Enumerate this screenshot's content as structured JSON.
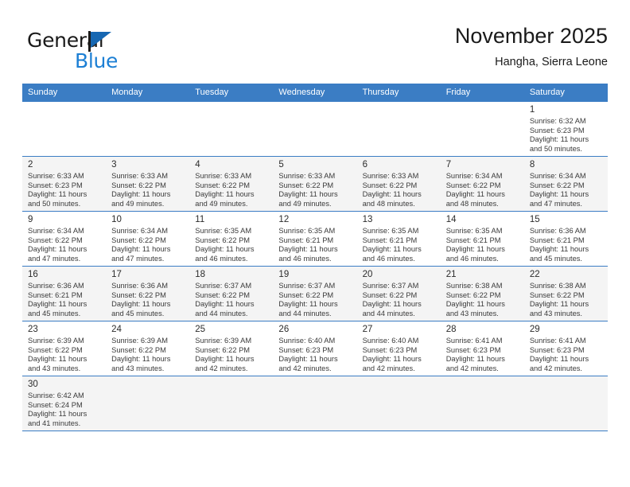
{
  "brand": {
    "name_part1": "General",
    "name_part2": "Blue",
    "flag_icon": "triangle-flag-icon",
    "accent_color": "#1c7fd4",
    "flag_color": "#1667b2"
  },
  "header": {
    "title": "November 2025",
    "subtitle": "Hangha, Sierra Leone"
  },
  "calendar": {
    "header_bg_color": "#3b7dc4",
    "alt_row_bg_color": "#f4f4f4",
    "weekday_headers": [
      "Sunday",
      "Monday",
      "Tuesday",
      "Wednesday",
      "Thursday",
      "Friday",
      "Saturday"
    ],
    "weeks": [
      [
        {
          "day": "",
          "sunrise": "",
          "sunset": "",
          "daylight_line1": "",
          "daylight_line2": ""
        },
        {
          "day": "",
          "sunrise": "",
          "sunset": "",
          "daylight_line1": "",
          "daylight_line2": ""
        },
        {
          "day": "",
          "sunrise": "",
          "sunset": "",
          "daylight_line1": "",
          "daylight_line2": ""
        },
        {
          "day": "",
          "sunrise": "",
          "sunset": "",
          "daylight_line1": "",
          "daylight_line2": ""
        },
        {
          "day": "",
          "sunrise": "",
          "sunset": "",
          "daylight_line1": "",
          "daylight_line2": ""
        },
        {
          "day": "",
          "sunrise": "",
          "sunset": "",
          "daylight_line1": "",
          "daylight_line2": ""
        },
        {
          "day": "1",
          "sunrise": "Sunrise: 6:32 AM",
          "sunset": "Sunset: 6:23 PM",
          "daylight_line1": "Daylight: 11 hours",
          "daylight_line2": "and 50 minutes."
        }
      ],
      [
        {
          "day": "2",
          "sunrise": "Sunrise: 6:33 AM",
          "sunset": "Sunset: 6:23 PM",
          "daylight_line1": "Daylight: 11 hours",
          "daylight_line2": "and 50 minutes."
        },
        {
          "day": "3",
          "sunrise": "Sunrise: 6:33 AM",
          "sunset": "Sunset: 6:22 PM",
          "daylight_line1": "Daylight: 11 hours",
          "daylight_line2": "and 49 minutes."
        },
        {
          "day": "4",
          "sunrise": "Sunrise: 6:33 AM",
          "sunset": "Sunset: 6:22 PM",
          "daylight_line1": "Daylight: 11 hours",
          "daylight_line2": "and 49 minutes."
        },
        {
          "day": "5",
          "sunrise": "Sunrise: 6:33 AM",
          "sunset": "Sunset: 6:22 PM",
          "daylight_line1": "Daylight: 11 hours",
          "daylight_line2": "and 49 minutes."
        },
        {
          "day": "6",
          "sunrise": "Sunrise: 6:33 AM",
          "sunset": "Sunset: 6:22 PM",
          "daylight_line1": "Daylight: 11 hours",
          "daylight_line2": "and 48 minutes."
        },
        {
          "day": "7",
          "sunrise": "Sunrise: 6:34 AM",
          "sunset": "Sunset: 6:22 PM",
          "daylight_line1": "Daylight: 11 hours",
          "daylight_line2": "and 48 minutes."
        },
        {
          "day": "8",
          "sunrise": "Sunrise: 6:34 AM",
          "sunset": "Sunset: 6:22 PM",
          "daylight_line1": "Daylight: 11 hours",
          "daylight_line2": "and 47 minutes."
        }
      ],
      [
        {
          "day": "9",
          "sunrise": "Sunrise: 6:34 AM",
          "sunset": "Sunset: 6:22 PM",
          "daylight_line1": "Daylight: 11 hours",
          "daylight_line2": "and 47 minutes."
        },
        {
          "day": "10",
          "sunrise": "Sunrise: 6:34 AM",
          "sunset": "Sunset: 6:22 PM",
          "daylight_line1": "Daylight: 11 hours",
          "daylight_line2": "and 47 minutes."
        },
        {
          "day": "11",
          "sunrise": "Sunrise: 6:35 AM",
          "sunset": "Sunset: 6:22 PM",
          "daylight_line1": "Daylight: 11 hours",
          "daylight_line2": "and 46 minutes."
        },
        {
          "day": "12",
          "sunrise": "Sunrise: 6:35 AM",
          "sunset": "Sunset: 6:21 PM",
          "daylight_line1": "Daylight: 11 hours",
          "daylight_line2": "and 46 minutes."
        },
        {
          "day": "13",
          "sunrise": "Sunrise: 6:35 AM",
          "sunset": "Sunset: 6:21 PM",
          "daylight_line1": "Daylight: 11 hours",
          "daylight_line2": "and 46 minutes."
        },
        {
          "day": "14",
          "sunrise": "Sunrise: 6:35 AM",
          "sunset": "Sunset: 6:21 PM",
          "daylight_line1": "Daylight: 11 hours",
          "daylight_line2": "and 46 minutes."
        },
        {
          "day": "15",
          "sunrise": "Sunrise: 6:36 AM",
          "sunset": "Sunset: 6:21 PM",
          "daylight_line1": "Daylight: 11 hours",
          "daylight_line2": "and 45 minutes."
        }
      ],
      [
        {
          "day": "16",
          "sunrise": "Sunrise: 6:36 AM",
          "sunset": "Sunset: 6:21 PM",
          "daylight_line1": "Daylight: 11 hours",
          "daylight_line2": "and 45 minutes."
        },
        {
          "day": "17",
          "sunrise": "Sunrise: 6:36 AM",
          "sunset": "Sunset: 6:22 PM",
          "daylight_line1": "Daylight: 11 hours",
          "daylight_line2": "and 45 minutes."
        },
        {
          "day": "18",
          "sunrise": "Sunrise: 6:37 AM",
          "sunset": "Sunset: 6:22 PM",
          "daylight_line1": "Daylight: 11 hours",
          "daylight_line2": "and 44 minutes."
        },
        {
          "day": "19",
          "sunrise": "Sunrise: 6:37 AM",
          "sunset": "Sunset: 6:22 PM",
          "daylight_line1": "Daylight: 11 hours",
          "daylight_line2": "and 44 minutes."
        },
        {
          "day": "20",
          "sunrise": "Sunrise: 6:37 AM",
          "sunset": "Sunset: 6:22 PM",
          "daylight_line1": "Daylight: 11 hours",
          "daylight_line2": "and 44 minutes."
        },
        {
          "day": "21",
          "sunrise": "Sunrise: 6:38 AM",
          "sunset": "Sunset: 6:22 PM",
          "daylight_line1": "Daylight: 11 hours",
          "daylight_line2": "and 43 minutes."
        },
        {
          "day": "22",
          "sunrise": "Sunrise: 6:38 AM",
          "sunset": "Sunset: 6:22 PM",
          "daylight_line1": "Daylight: 11 hours",
          "daylight_line2": "and 43 minutes."
        }
      ],
      [
        {
          "day": "23",
          "sunrise": "Sunrise: 6:39 AM",
          "sunset": "Sunset: 6:22 PM",
          "daylight_line1": "Daylight: 11 hours",
          "daylight_line2": "and 43 minutes."
        },
        {
          "day": "24",
          "sunrise": "Sunrise: 6:39 AM",
          "sunset": "Sunset: 6:22 PM",
          "daylight_line1": "Daylight: 11 hours",
          "daylight_line2": "and 43 minutes."
        },
        {
          "day": "25",
          "sunrise": "Sunrise: 6:39 AM",
          "sunset": "Sunset: 6:22 PM",
          "daylight_line1": "Daylight: 11 hours",
          "daylight_line2": "and 42 minutes."
        },
        {
          "day": "26",
          "sunrise": "Sunrise: 6:40 AM",
          "sunset": "Sunset: 6:23 PM",
          "daylight_line1": "Daylight: 11 hours",
          "daylight_line2": "and 42 minutes."
        },
        {
          "day": "27",
          "sunrise": "Sunrise: 6:40 AM",
          "sunset": "Sunset: 6:23 PM",
          "daylight_line1": "Daylight: 11 hours",
          "daylight_line2": "and 42 minutes."
        },
        {
          "day": "28",
          "sunrise": "Sunrise: 6:41 AM",
          "sunset": "Sunset: 6:23 PM",
          "daylight_line1": "Daylight: 11 hours",
          "daylight_line2": "and 42 minutes."
        },
        {
          "day": "29",
          "sunrise": "Sunrise: 6:41 AM",
          "sunset": "Sunset: 6:23 PM",
          "daylight_line1": "Daylight: 11 hours",
          "daylight_line2": "and 42 minutes."
        }
      ],
      [
        {
          "day": "30",
          "sunrise": "Sunrise: 6:42 AM",
          "sunset": "Sunset: 6:24 PM",
          "daylight_line1": "Daylight: 11 hours",
          "daylight_line2": "and 41 minutes."
        },
        {
          "day": "",
          "sunrise": "",
          "sunset": "",
          "daylight_line1": "",
          "daylight_line2": ""
        },
        {
          "day": "",
          "sunrise": "",
          "sunset": "",
          "daylight_line1": "",
          "daylight_line2": ""
        },
        {
          "day": "",
          "sunrise": "",
          "sunset": "",
          "daylight_line1": "",
          "daylight_line2": ""
        },
        {
          "day": "",
          "sunrise": "",
          "sunset": "",
          "daylight_line1": "",
          "daylight_line2": ""
        },
        {
          "day": "",
          "sunrise": "",
          "sunset": "",
          "daylight_line1": "",
          "daylight_line2": ""
        },
        {
          "day": "",
          "sunrise": "",
          "sunset": "",
          "daylight_line1": "",
          "daylight_line2": ""
        }
      ]
    ]
  }
}
